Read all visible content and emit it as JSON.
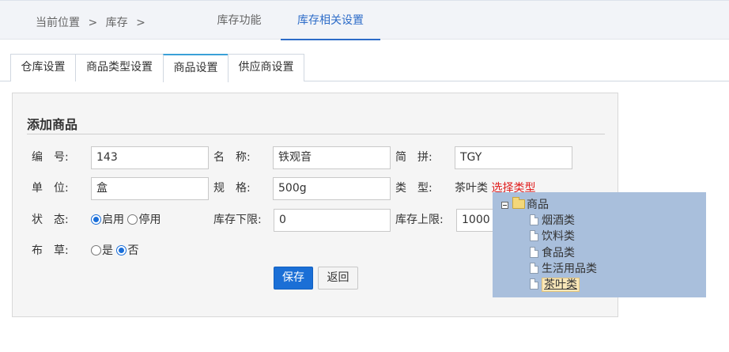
{
  "breadcrumb": {
    "current_label": "当前位置",
    "sep1": ">",
    "section": "库存",
    "sep2": ">"
  },
  "top_tabs": {
    "tab1": "库存功能",
    "tab2": "库存相关设置"
  },
  "sub_tabs": [
    "仓库设置",
    "商品类型设置",
    "商品设置",
    "供应商设置"
  ],
  "form": {
    "title": "添加商品",
    "code_label": "编　号:",
    "code_value": "143",
    "name_label": "名　称:",
    "name_value": "铁观音",
    "pinyin_label": "简　拼:",
    "pinyin_value": "TGY",
    "unit_label": "单　位:",
    "unit_value": "盒",
    "spec_label": "规　格:",
    "spec_value": "500g",
    "type_label": "类　型:",
    "type_value": "茶叶类",
    "type_link": "选择类型",
    "status_label": "状　态:",
    "status_opt_on": "启用",
    "status_opt_off": "停用",
    "stock_min_label": "库存下限:",
    "stock_min_value": "0",
    "stock_max_label": "库存上限:",
    "stock_max_value": "1000",
    "buzhi_label": "布　草:",
    "buzhi_opt_yes": "是",
    "buzhi_opt_no": "否",
    "save_label": "保存",
    "back_label": "返回"
  },
  "tree": {
    "root": "商品",
    "children": [
      "烟酒类",
      "饮料类",
      "食品类",
      "生活用品类",
      "茶叶类"
    ],
    "selected": "茶叶类"
  },
  "colors": {
    "accent": "#2d6cc8",
    "primary_button": "#1b6fd6",
    "link_red": "#e02020",
    "tree_bg": "#a9bfdc"
  }
}
